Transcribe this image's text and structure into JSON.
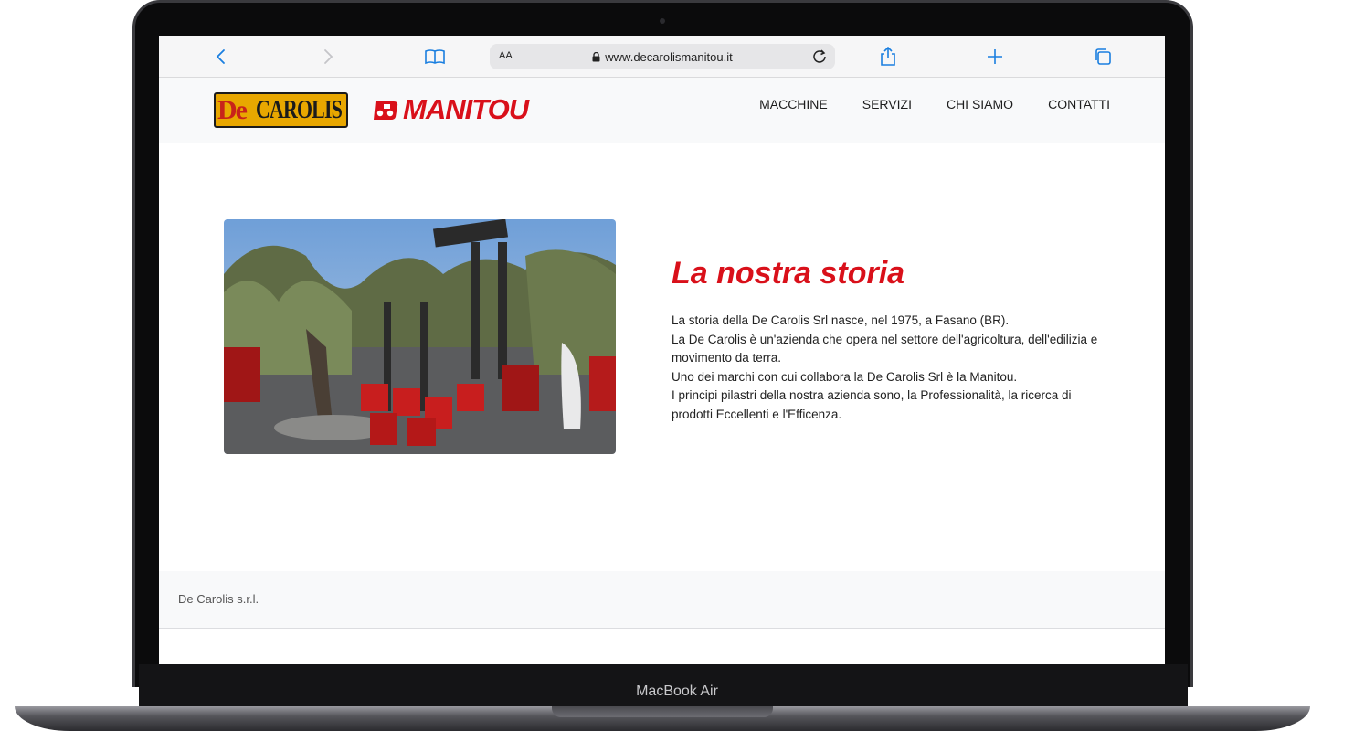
{
  "device": {
    "label": "MacBook Air"
  },
  "browser": {
    "text_size_label": "AA",
    "url": "www.decarolismanitou.it",
    "icons": [
      "back-icon",
      "forward-icon",
      "bookmarks-icon",
      "lock-icon",
      "reload-icon",
      "share-icon",
      "new-tab-icon",
      "tabs-icon"
    ]
  },
  "header": {
    "logo_left_de": "De",
    "logo_left_carolis": "CAROLIS",
    "logo_right": "MANITOU",
    "nav": [
      "MACCHINE",
      "SERVIZI",
      "CHI SIAMO",
      "CONTATTI"
    ]
  },
  "story": {
    "title": "La nostra storia",
    "paragraphs": [
      "La storia della De Carolis Srl nasce, nel 1975, a Fasano (BR).",
      "La De Carolis è un'azienda che opera nel settore dell'agricoltura, dell'edilizia e movimento da terra.",
      "Uno dei marchi con cui collabora la De Carolis Srl è la Manitou.",
      "I principi pilastri della nostra azienda sono, la Professionalità, la ricerca di prodotti Eccellenti e l'Efficenza."
    ]
  },
  "footer": {
    "company": "De Carolis s.r.l."
  },
  "colors": {
    "accent_red": "#d9101a",
    "link_blue": "#1a7fe0"
  }
}
